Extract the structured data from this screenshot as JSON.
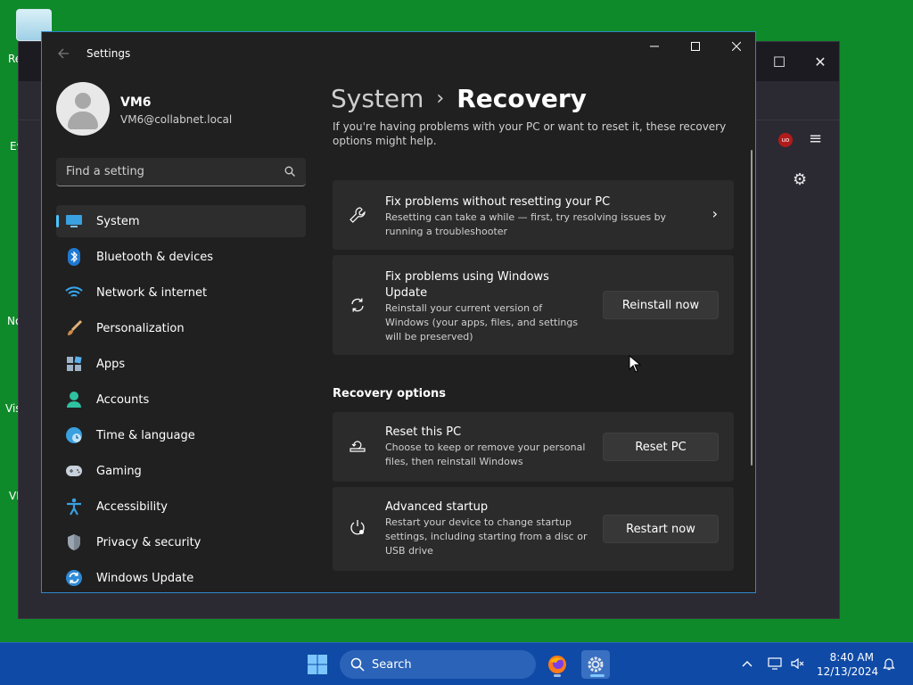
{
  "desktop": {
    "icon_labels": [
      "Re",
      "Ev",
      "No",
      "Vis",
      "VL"
    ]
  },
  "settings": {
    "app_title": "Settings",
    "profile": {
      "name": "VM6",
      "email": "VM6@collabnet.local"
    },
    "search": {
      "placeholder": "Find a setting"
    },
    "nav": [
      {
        "label": "System",
        "icon": "system-icon",
        "active": true
      },
      {
        "label": "Bluetooth & devices",
        "icon": "bluetooth-icon"
      },
      {
        "label": "Network & internet",
        "icon": "wifi-icon"
      },
      {
        "label": "Personalization",
        "icon": "brush-icon"
      },
      {
        "label": "Apps",
        "icon": "apps-icon"
      },
      {
        "label": "Accounts",
        "icon": "account-icon"
      },
      {
        "label": "Time & language",
        "icon": "globe-clock-icon"
      },
      {
        "label": "Gaming",
        "icon": "gamepad-icon"
      },
      {
        "label": "Accessibility",
        "icon": "accessibility-icon"
      },
      {
        "label": "Privacy & security",
        "icon": "shield-icon"
      },
      {
        "label": "Windows Update",
        "icon": "update-icon"
      }
    ],
    "breadcrumb": {
      "parent": "System",
      "separator": "›",
      "current": "Recovery"
    },
    "intro": "If you're having problems with your PC or want to reset it, these recovery options might help.",
    "cards": {
      "fix_no_reset": {
        "title": "Fix problems without resetting your PC",
        "desc": "Resetting can take a while — first, try resolving issues by running a troubleshooter"
      },
      "windows_update": {
        "title": "Fix problems using Windows Update",
        "desc": "Reinstall your current version of Windows (your apps, files, and settings will be preserved)",
        "button": "Reinstall now"
      }
    },
    "recovery_section_title": "Recovery options",
    "recovery_cards": {
      "reset": {
        "title": "Reset this PC",
        "desc": "Choose to keep or remove your personal files, then reinstall Windows",
        "button": "Reset PC"
      },
      "advanced": {
        "title": "Advanced startup",
        "desc": "Restart your device to change startup settings, including starting from a disc or USB drive",
        "button": "Restart now"
      }
    }
  },
  "taskbar": {
    "search_label": "Search",
    "time": "8:40 AM",
    "date": "12/13/2024"
  },
  "colors": {
    "accent": "#4cc2ff",
    "desktop_bg": "#0f8a2a",
    "window_bg": "#202020",
    "card_bg": "#2b2b2b",
    "taskbar_bg": "#0f4aa6"
  }
}
